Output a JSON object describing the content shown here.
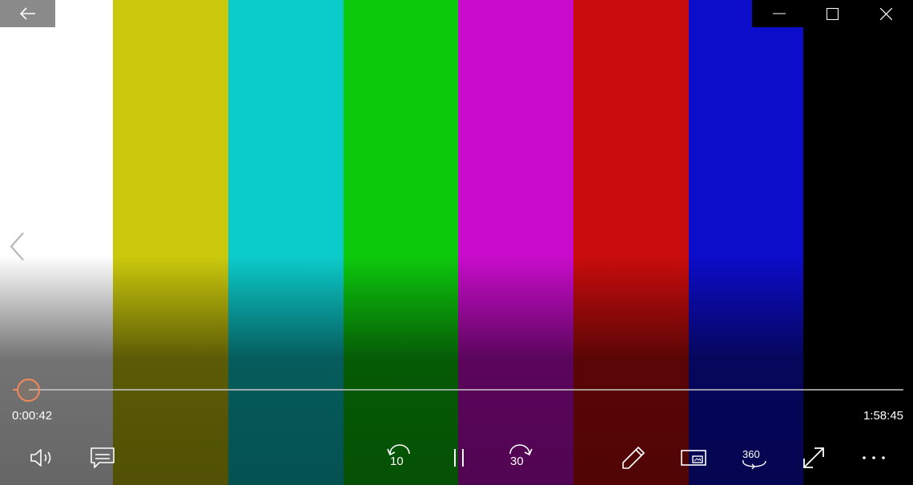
{
  "video": {
    "bars": [
      "#ffffff",
      "#cbc90c",
      "#0ccbcb",
      "#0cc90c",
      "#c90ccb",
      "#c90c0c",
      "#0c0ccb",
      "#000000"
    ]
  },
  "accent": "#f0895c",
  "titlebar": {
    "back_icon": "arrow-left-icon",
    "minimize_icon": "minimize-icon",
    "maximize_icon": "maximize-icon",
    "close_icon": "close-icon"
  },
  "navigation": {
    "previous_icon": "chevron-left-icon"
  },
  "playback": {
    "elapsed": "0:00:42",
    "total": "1:58:45",
    "progress": 0.006
  },
  "controls": {
    "volume_icon": "volume-icon",
    "subtitles_icon": "subtitles-icon",
    "skip_back_label": "10",
    "pause_icon": "pause-icon",
    "skip_forward_label": "30",
    "edit_icon": "pencil-icon",
    "miniview_icon": "mini-view-icon",
    "view360_label": "360",
    "fullscreen_icon": "fullscreen-icon",
    "more_icon": "more-icon"
  }
}
